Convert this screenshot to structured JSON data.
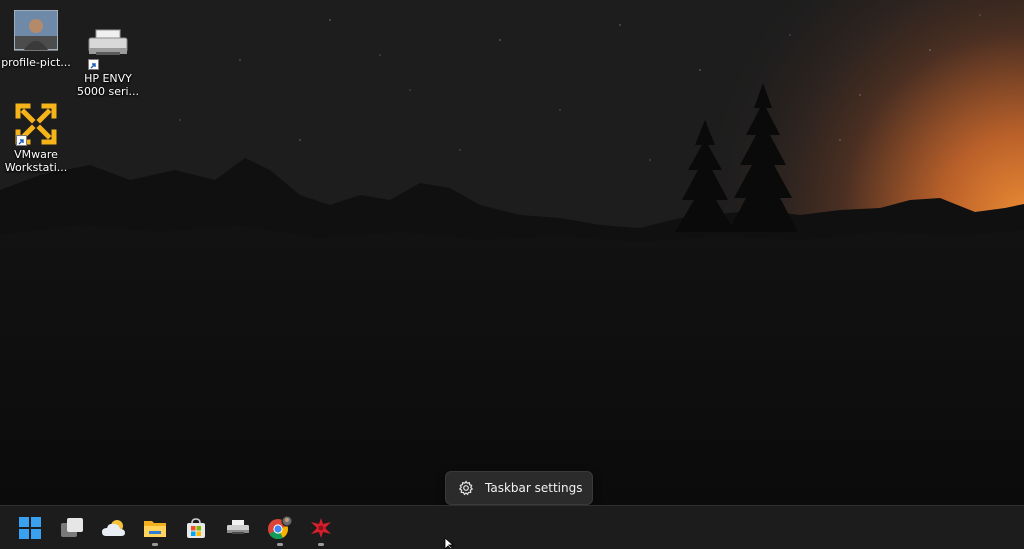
{
  "desktop_icons": [
    {
      "name": "profile-picture",
      "label": "profile-pict...",
      "icon": "photo-icon"
    },
    {
      "name": "hp-envy-printer",
      "label": "HP ENVY 5000 seri...",
      "icon": "printer-icon"
    },
    {
      "name": "vmware-workstation",
      "label": "VMware Workstati...",
      "icon": "vmware-icon"
    }
  ],
  "tooltip": {
    "label": "Taskbar settings",
    "icon": "gear-icon"
  },
  "taskbar": {
    "items": [
      {
        "name": "start",
        "icon": "windows-logo-icon",
        "running": false
      },
      {
        "name": "task-view",
        "icon": "task-view-icon",
        "running": false
      },
      {
        "name": "widgets",
        "icon": "weather-cloud-icon",
        "running": false
      },
      {
        "name": "file-explorer",
        "icon": "folder-icon",
        "running": true
      },
      {
        "name": "microsoft-store",
        "icon": "store-bag-icon",
        "running": false
      },
      {
        "name": "printer-app",
        "icon": "printer-icon",
        "running": false
      },
      {
        "name": "chrome",
        "icon": "chrome-icon",
        "running": true
      },
      {
        "name": "red-app",
        "icon": "red-bird-icon",
        "running": true
      }
    ]
  },
  "colors": {
    "taskbar_bg": "#1c1c1c",
    "tooltip_bg": "#2b2b2b",
    "vmware_yellow": "#f4b41a",
    "sunset_orange": "#d97a2a"
  }
}
